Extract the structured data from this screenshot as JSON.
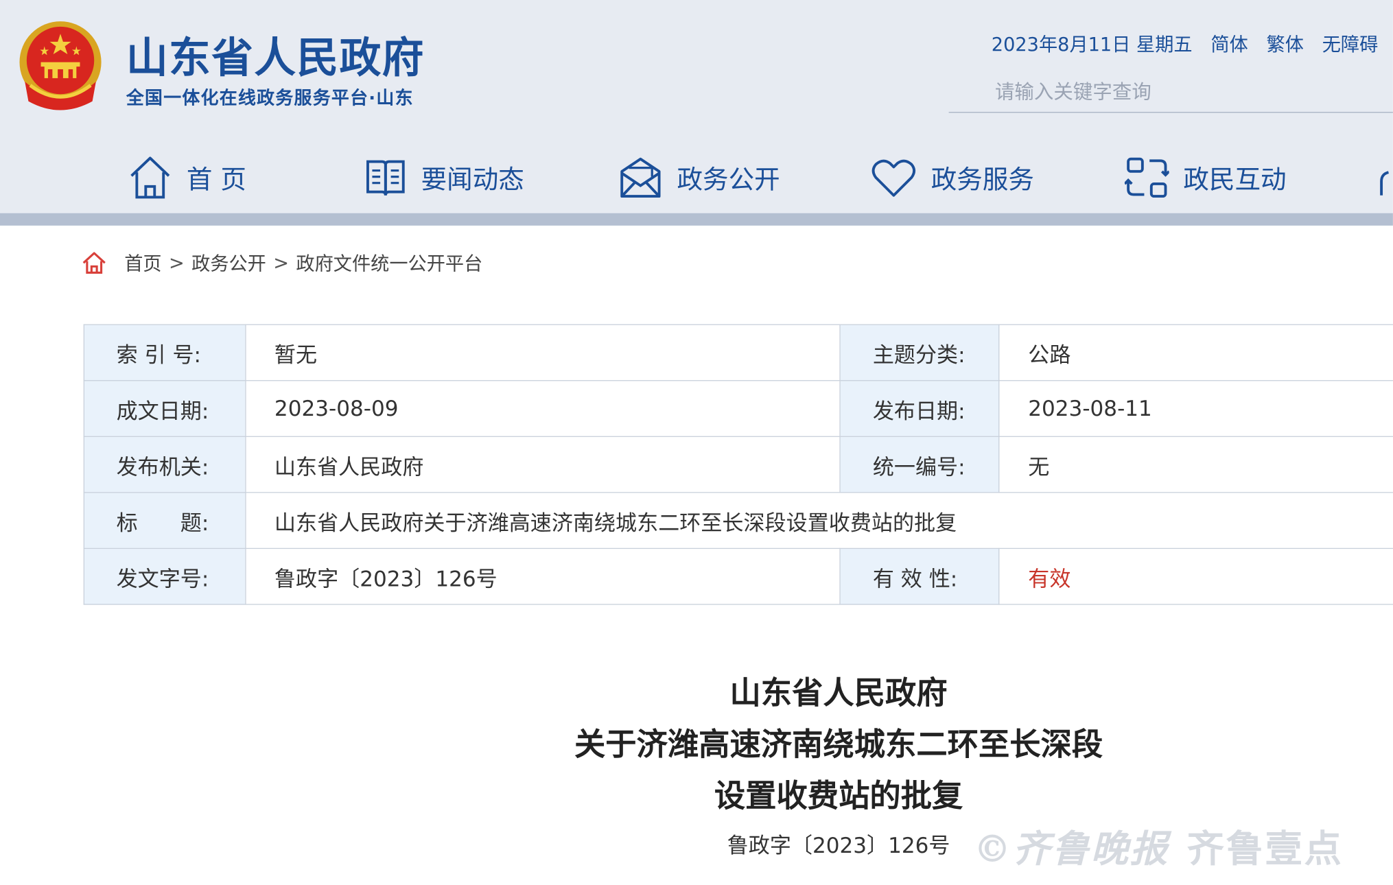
{
  "header": {
    "site_title": "山东省人民政府",
    "site_subtitle": "全国一体化在线政务服务平台·山东",
    "date_text": "2023年8月11日 星期五",
    "lang_simplified": "简体",
    "lang_traditional": "繁体",
    "accessibility": "无障碍",
    "search_placeholder": "请输入关键字查询",
    "brand_color": "#1b4f99"
  },
  "nav": {
    "items": [
      {
        "label": "首 页",
        "icon": "home-icon"
      },
      {
        "label": "要闻动态",
        "icon": "book-icon"
      },
      {
        "label": "政务公开",
        "icon": "mail-icon"
      },
      {
        "label": "政务服务",
        "icon": "heart-icon"
      },
      {
        "label": "政民互动",
        "icon": "interaction-icon"
      }
    ]
  },
  "breadcrumb": [
    "首页",
    "政务公开",
    "政府文件统一公开平台"
  ],
  "info": {
    "index_label": "索 引 号:",
    "index_value": "暂无",
    "topic_label": "主题分类:",
    "topic_value": "公路",
    "written_date_label": "成文日期:",
    "written_date_value": "2023-08-09",
    "publish_date_label": "发布日期:",
    "publish_date_value": "2023-08-11",
    "issuer_label": "发布机关:",
    "issuer_value": "山东省人民政府",
    "serial_label": "统一编号:",
    "serial_value": "无",
    "title_label": "标　　题:",
    "title_value": "山东省人民政府关于济潍高速济南绕城东二环至长深段设置收费站的批复",
    "doc_number_label": "发文字号:",
    "doc_number_value": "鲁政字〔2023〕126号",
    "validity_label": "有 效 性:",
    "validity_value": "有效",
    "validity_color": "#c8352a"
  },
  "document": {
    "title_line1": "山东省人民政府",
    "title_line2": "关于济潍高速济南绕城东二环至长深段",
    "title_line3": "设置收费站的批复",
    "number": "鲁政字〔2023〕126号"
  },
  "watermark": {
    "text1": "©齐鲁晚报",
    "text2": "齐鲁壹点"
  }
}
